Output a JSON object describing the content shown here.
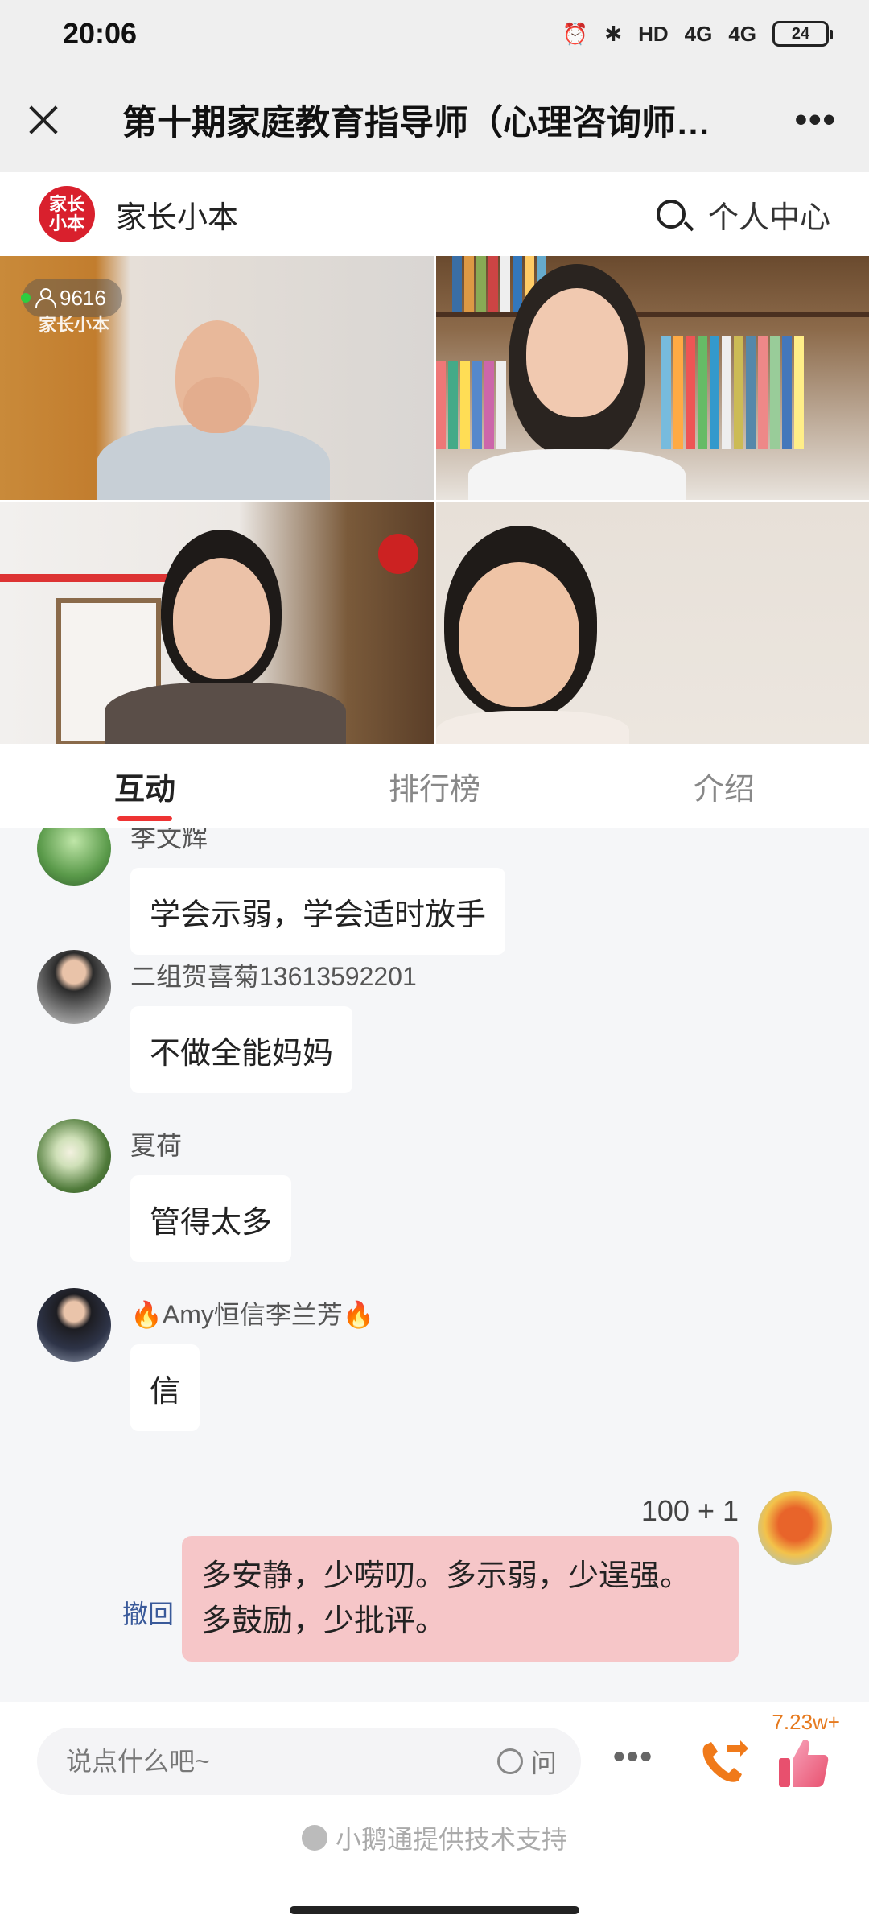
{
  "status_bar": {
    "time": "20:06",
    "signal_1": "4G",
    "signal_2": "4G",
    "hd": "HD",
    "battery": "24"
  },
  "header": {
    "title": "第十期家庭教育指导师（心理咨询师…",
    "more": "•••"
  },
  "brand": {
    "logo_text": "家长小本",
    "name": "家长小本",
    "profile_label": "个人中心"
  },
  "live": {
    "viewers": "9616",
    "watermark": "家长小本"
  },
  "tabs": [
    {
      "label": "互动"
    },
    {
      "label": "排行榜"
    },
    {
      "label": "介绍"
    }
  ],
  "messages": [
    {
      "sender": "李文辉",
      "text": "学会示弱，学会适时放手"
    },
    {
      "sender": "二组贺喜菊13613592201",
      "text": "不做全能妈妈"
    },
    {
      "sender": "夏荷",
      "text": "管得太多"
    },
    {
      "sender": "🔥Amy恒信李兰芳🔥",
      "text": "信"
    }
  ],
  "self_message": {
    "count": "100 + 1",
    "line1": "多安静，少唠叨。多示弱，少逞强。",
    "line2": "多鼓励，少批评。",
    "recall_label": "撤回"
  },
  "input": {
    "placeholder": "说点什么吧~",
    "ask_label": "问",
    "like_count": "7.23w+"
  },
  "footer": {
    "powered_by": "小鹅通提供技术支持"
  },
  "colors": {
    "accent": "#e33333",
    "brand_red": "#d9202d",
    "self_bubble": "#f6c6c8",
    "like_orange": "#e67a1f"
  }
}
